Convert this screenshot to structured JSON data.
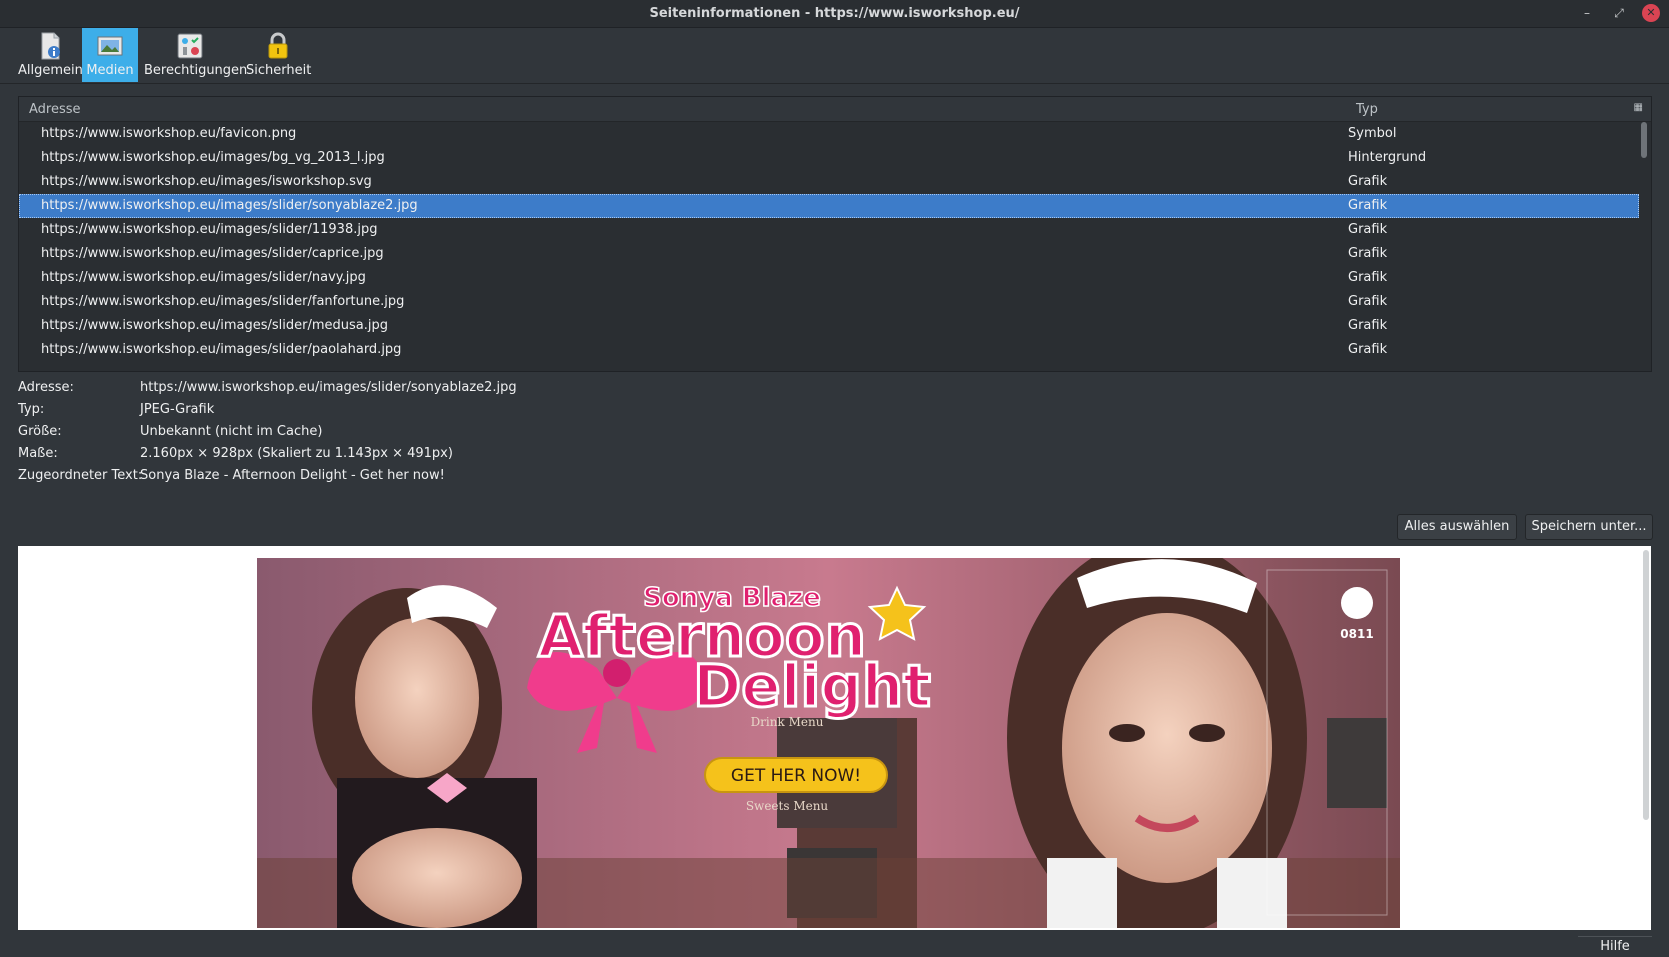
{
  "window": {
    "title": "Seiteninformationen - https://www.isworkshop.eu/",
    "minimize_glyph": "–",
    "maximize_glyph": "⤢",
    "close_glyph": "✕"
  },
  "toolbar": {
    "tabs": [
      {
        "label": "Allgemein",
        "icon": "general-info-icon",
        "active": false
      },
      {
        "label": "Medien",
        "icon": "media-icon",
        "active": true
      },
      {
        "label": "Berechtigungen",
        "icon": "permissions-icon",
        "active": false
      },
      {
        "label": "Sicherheit",
        "icon": "lock-icon",
        "active": false
      }
    ]
  },
  "media_list": {
    "columns": {
      "address": "Adresse",
      "type": "Typ"
    },
    "rows": [
      {
        "address": "https://www.isworkshop.eu/favicon.png",
        "type": "Symbol"
      },
      {
        "address": "https://www.isworkshop.eu/images/bg_vg_2013_l.jpg",
        "type": "Hintergrund"
      },
      {
        "address": "https://www.isworkshop.eu/images/isworkshop.svg",
        "type": "Grafik"
      },
      {
        "address": "https://www.isworkshop.eu/images/slider/sonyablaze2.jpg",
        "type": "Grafik",
        "selected": true
      },
      {
        "address": "https://www.isworkshop.eu/images/slider/11938.jpg",
        "type": "Grafik"
      },
      {
        "address": "https://www.isworkshop.eu/images/slider/caprice.jpg",
        "type": "Grafik"
      },
      {
        "address": "https://www.isworkshop.eu/images/slider/navy.jpg",
        "type": "Grafik"
      },
      {
        "address": "https://www.isworkshop.eu/images/slider/fanfortune.jpg",
        "type": "Grafik"
      },
      {
        "address": "https://www.isworkshop.eu/images/slider/medusa.jpg",
        "type": "Grafik"
      },
      {
        "address": "https://www.isworkshop.eu/images/slider/paolahard.jpg",
        "type": "Grafik"
      }
    ]
  },
  "details": [
    {
      "label": "Adresse:",
      "value": "https://www.isworkshop.eu/images/slider/sonyablaze2.jpg"
    },
    {
      "label": "Typ:",
      "value": "JPEG-Grafik"
    },
    {
      "label": "Größe:",
      "value": "Unbekannt (nicht im Cache)"
    },
    {
      "label": "Maße:",
      "value": "2.160px × 928px (Skaliert zu 1.143px × 491px)"
    },
    {
      "label": "Zugeordneter Text:",
      "value": "Sonya Blaze - Afternoon Delight - Get her now!"
    }
  ],
  "buttons": {
    "select_all": "Alles auswählen",
    "save_as": "Speichern unter...",
    "help": "Hilfe"
  },
  "preview": {
    "banner_name": "Sonya Blaze",
    "banner_title_line1": "Afternoon",
    "banner_title_line2": "Delight",
    "cta": "GET HER NOW!",
    "logo_code": "0811",
    "sign_drink": "Drink Menu",
    "sign_sweets": "Sweets Menu",
    "colors": {
      "title_pink": "#e0206f",
      "cta_yellow": "#f5c21b",
      "bow_pink": "#f03c8c"
    }
  }
}
